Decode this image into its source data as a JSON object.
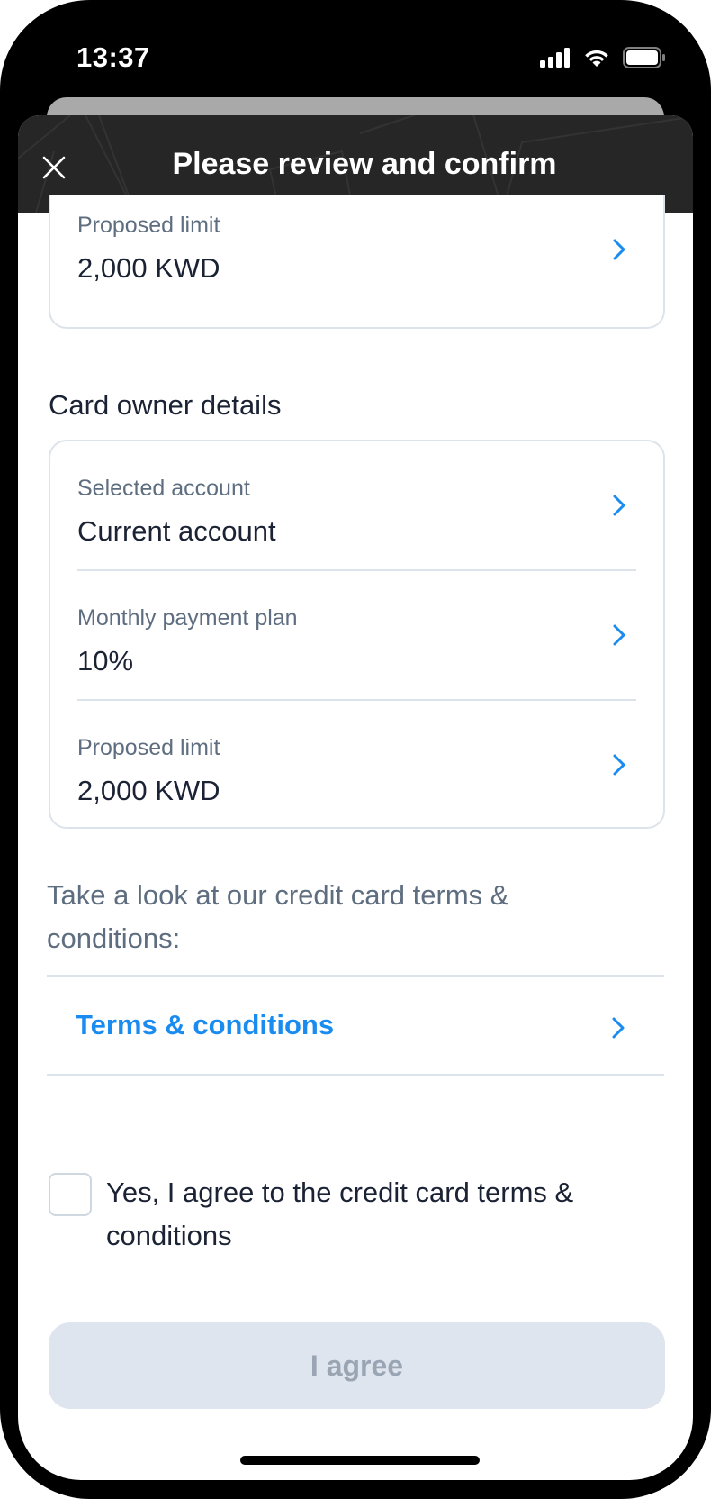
{
  "status_bar": {
    "time": "13:37"
  },
  "header": {
    "title": "Please review and confirm",
    "close_icon": "close-icon"
  },
  "summary_card": {
    "label": "Proposed limit",
    "value": "2,000 KWD"
  },
  "card_owner": {
    "section_title": "Card owner details",
    "rows": [
      {
        "label": "Selected account",
        "value": "Current account"
      },
      {
        "label": "Monthly payment plan",
        "value": "10%"
      },
      {
        "label": "Proposed limit",
        "value": "2,000 KWD"
      }
    ]
  },
  "terms": {
    "intro": "Take a look at our credit card terms & conditions:",
    "link_label": "Terms & conditions"
  },
  "agreement": {
    "checkbox_checked": false,
    "checkbox_label": "Yes, I agree to the credit card terms & conditions"
  },
  "primary_button": {
    "label": "I agree",
    "disabled": true
  },
  "colors": {
    "header_background": "#262626",
    "link_blue": "#1a8cf0",
    "disabled_button_bg": "#dfe5ee",
    "disabled_button_text": "#9aa5b4"
  }
}
